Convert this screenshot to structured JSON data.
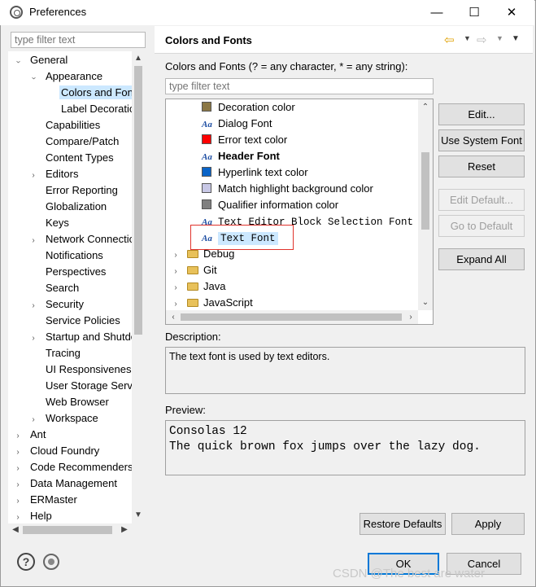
{
  "window": {
    "title": "Preferences",
    "minimize": "—",
    "maximize": "☐",
    "close": "✕"
  },
  "left": {
    "filter_placeholder": "type filter text",
    "tree": [
      {
        "label": "General",
        "level": 0,
        "tw": "open"
      },
      {
        "label": "Appearance",
        "level": 1,
        "tw": "open"
      },
      {
        "label": "Colors and Fonts",
        "level": 2,
        "tw": "none",
        "selected": true
      },
      {
        "label": "Label Decorations",
        "level": 2,
        "tw": "none"
      },
      {
        "label": "Capabilities",
        "level": 1,
        "tw": "none"
      },
      {
        "label": "Compare/Patch",
        "level": 1,
        "tw": "none"
      },
      {
        "label": "Content Types",
        "level": 1,
        "tw": "none"
      },
      {
        "label": "Editors",
        "level": 1,
        "tw": "closed"
      },
      {
        "label": "Error Reporting",
        "level": 1,
        "tw": "none"
      },
      {
        "label": "Globalization",
        "level": 1,
        "tw": "none"
      },
      {
        "label": "Keys",
        "level": 1,
        "tw": "none"
      },
      {
        "label": "Network Connections",
        "level": 1,
        "tw": "closed"
      },
      {
        "label": "Notifications",
        "level": 1,
        "tw": "none"
      },
      {
        "label": "Perspectives",
        "level": 1,
        "tw": "none"
      },
      {
        "label": "Search",
        "level": 1,
        "tw": "none"
      },
      {
        "label": "Security",
        "level": 1,
        "tw": "closed"
      },
      {
        "label": "Service Policies",
        "level": 1,
        "tw": "none"
      },
      {
        "label": "Startup and Shutdown",
        "level": 1,
        "tw": "closed"
      },
      {
        "label": "Tracing",
        "level": 1,
        "tw": "none"
      },
      {
        "label": "UI Responsiveness Monitoring",
        "level": 1,
        "tw": "none"
      },
      {
        "label": "User Storage Service",
        "level": 1,
        "tw": "none"
      },
      {
        "label": "Web Browser",
        "level": 1,
        "tw": "none"
      },
      {
        "label": "Workspace",
        "level": 1,
        "tw": "closed"
      },
      {
        "label": "Ant",
        "level": 0,
        "tw": "closed"
      },
      {
        "label": "Cloud Foundry",
        "level": 0,
        "tw": "closed"
      },
      {
        "label": "Code Recommenders",
        "level": 0,
        "tw": "closed"
      },
      {
        "label": "Data Management",
        "level": 0,
        "tw": "closed"
      },
      {
        "label": "ERMaster",
        "level": 0,
        "tw": "closed"
      },
      {
        "label": "Help",
        "level": 0,
        "tw": "closed"
      }
    ]
  },
  "right": {
    "page_title": "Colors and Fonts",
    "intro": "Colors and Fonts (? = any character, * = any string):",
    "filter_placeholder": "type filter text",
    "items": [
      {
        "label": "Decoration color",
        "kind": "color",
        "color": "#8b7745"
      },
      {
        "label": "Dialog Font",
        "kind": "font"
      },
      {
        "label": "Error text color",
        "kind": "color",
        "color": "#ff0000"
      },
      {
        "label": "Header Font",
        "kind": "font",
        "bold": true
      },
      {
        "label": "Hyperlink text color",
        "kind": "color",
        "color": "#0a64c8"
      },
      {
        "label": "Match highlight background color",
        "kind": "color",
        "color": "#c8c8e6"
      },
      {
        "label": "Qualifier information color",
        "kind": "color",
        "color": "#808080"
      },
      {
        "label": "Text Editor Block Selection Font",
        "kind": "font",
        "mono": true
      },
      {
        "label": "Text Font",
        "kind": "font",
        "mono": true,
        "selected": true
      },
      {
        "label": "Debug",
        "kind": "category"
      },
      {
        "label": "Git",
        "kind": "category"
      },
      {
        "label": "Java",
        "kind": "category"
      },
      {
        "label": "JavaScript",
        "kind": "category"
      }
    ],
    "buttons": {
      "edit": "Edit...",
      "use_system_font": "Use System Font",
      "reset": "Reset",
      "edit_default": "Edit Default...",
      "go_to_default": "Go to Default",
      "expand_all": "Expand All"
    },
    "description_label": "Description:",
    "description": "The text font is used by text editors.",
    "preview_label": "Preview:",
    "preview_line1": "Consolas 12",
    "preview_line2": "The quick brown fox jumps over the lazy dog.",
    "restore_defaults": "Restore Defaults",
    "apply": "Apply"
  },
  "footer": {
    "ok": "OK",
    "cancel": "Cancel",
    "help_glyph": "?"
  },
  "watermark": "CSDN @The best are water",
  "accent": "#0078d7",
  "highlight_border": "#e0332c"
}
